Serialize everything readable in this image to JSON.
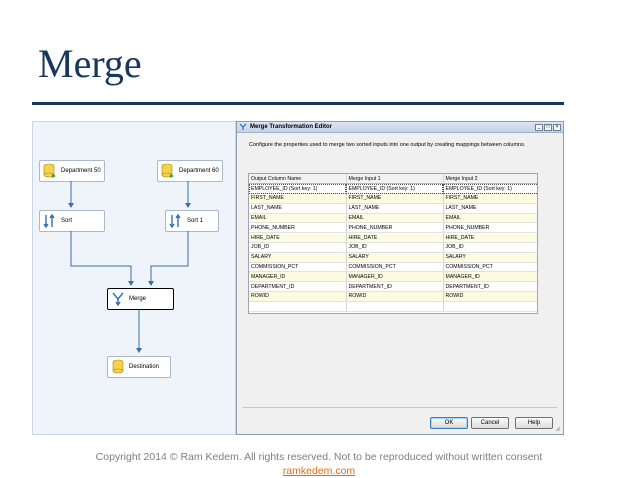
{
  "slide": {
    "title": "Merge",
    "accent_color": "#17375e"
  },
  "canvas": {
    "tasks": [
      {
        "label": "Department 50",
        "icon": "database-source-icon"
      },
      {
        "label": "Department 60",
        "icon": "database-source-icon"
      },
      {
        "label": "Sort",
        "icon": "sort-icon"
      },
      {
        "label": "Sort 1",
        "icon": "sort-icon"
      },
      {
        "label": "Merge",
        "icon": "merge-icon"
      },
      {
        "label": "Destination",
        "icon": "database-destination-icon"
      }
    ]
  },
  "dialog": {
    "title": "Merge Transformation Editor",
    "controls": {
      "minimize": "_",
      "maximize": "□",
      "close": "×"
    },
    "description": "Configure the properties used to merge two sorted inputs into one output by creating mappings between columns.",
    "columns": [
      "Output Column Name",
      "Merge Input 1",
      "Merge Input 2"
    ],
    "rows": [
      [
        "EMPLOYEE_ID (Sort key: 1)",
        "EMPLOYEE_ID (Sort key: 1)",
        "EMPLOYEE_ID (Sort key: 1)"
      ],
      [
        "FIRST_NAME",
        "FIRST_NAME",
        "FIRST_NAME"
      ],
      [
        "LAST_NAME",
        "LAST_NAME",
        "LAST_NAME"
      ],
      [
        "EMAIL",
        "EMAIL",
        "EMAIL"
      ],
      [
        "PHONE_NUMBER",
        "PHONE_NUMBER",
        "PHONE_NUMBER"
      ],
      [
        "HIRE_DATE",
        "HIRE_DATE",
        "HIRE_DATE"
      ],
      [
        "JOB_ID",
        "JOB_ID",
        "JOB_ID"
      ],
      [
        "SALARY",
        "SALARY",
        "SALARY"
      ],
      [
        "COMMISSION_PCT",
        "COMMISSION_PCT",
        "COMMISSION_PCT"
      ],
      [
        "MANAGER_ID",
        "MANAGER_ID",
        "MANAGER_ID"
      ],
      [
        "DEPARTMENT_ID",
        "DEPARTMENT_ID",
        "DEPARTMENT_ID"
      ],
      [
        "ROWID",
        "ROWID",
        "ROWID"
      ],
      [
        "",
        "",
        ""
      ]
    ],
    "buttons": {
      "ok": "OK",
      "cancel": "Cancel",
      "help": "Help"
    }
  },
  "footer": {
    "copyright": "Copyright 2014 © Ram Kedem. All rights reserved. Not to be reproduced without written consent",
    "link": "ramkedem.com"
  }
}
